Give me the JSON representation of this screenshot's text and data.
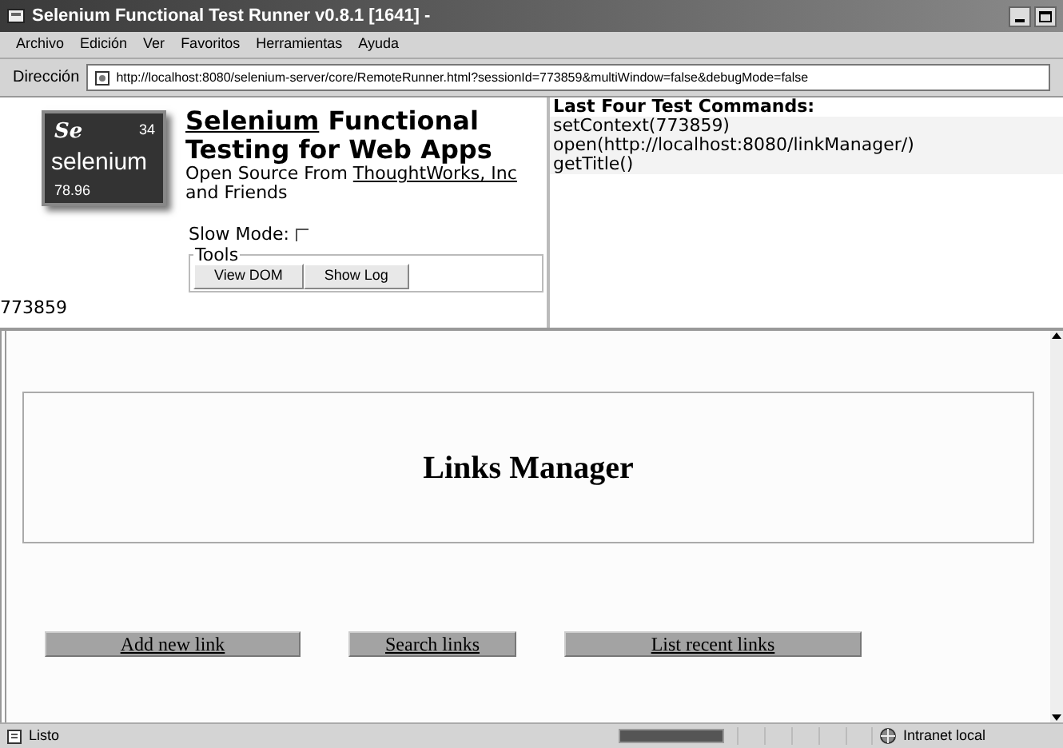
{
  "window": {
    "title": "Selenium Functional Test Runner v0.8.1 [1641] -"
  },
  "menu": [
    "Archivo",
    "Edición",
    "Ver",
    "Favoritos",
    "Herramientas",
    "Ayuda"
  ],
  "address_bar": {
    "label": "Dirección",
    "url": "http://localhost:8080/selenium-server/core/RemoteRunner.html?sessionId=773859&multiWindow=false&debugMode=false"
  },
  "logo": {
    "symbol": "Se",
    "number": "34",
    "name": "selenium",
    "mass": "78.96"
  },
  "header": {
    "title_link": "Selenium",
    "title_rest": " Functional",
    "title_line2": "Testing for Web Apps",
    "subtitle": "Open Source From ",
    "subtitle_link": "ThoughtWorks, Inc",
    "subtitle_end": "and Friends"
  },
  "slow_mode": {
    "label": "Slow Mode:",
    "checked": false
  },
  "tools": {
    "legend": "Tools",
    "buttons": [
      "View DOM",
      "Show Log"
    ]
  },
  "session_id": "773859",
  "commands": {
    "title": "Last Four Test Commands:",
    "items": [
      "setContext(773859)",
      "open(http://localhost:8080/linkManager/)",
      "getTitle()"
    ]
  },
  "app": {
    "heading": "Links Manager",
    "links": [
      "Add new link",
      "Search links",
      "List recent links"
    ]
  },
  "status_bar": {
    "text": "Listo",
    "progress": {
      "level": 1
    },
    "zone": "Intranet local"
  }
}
